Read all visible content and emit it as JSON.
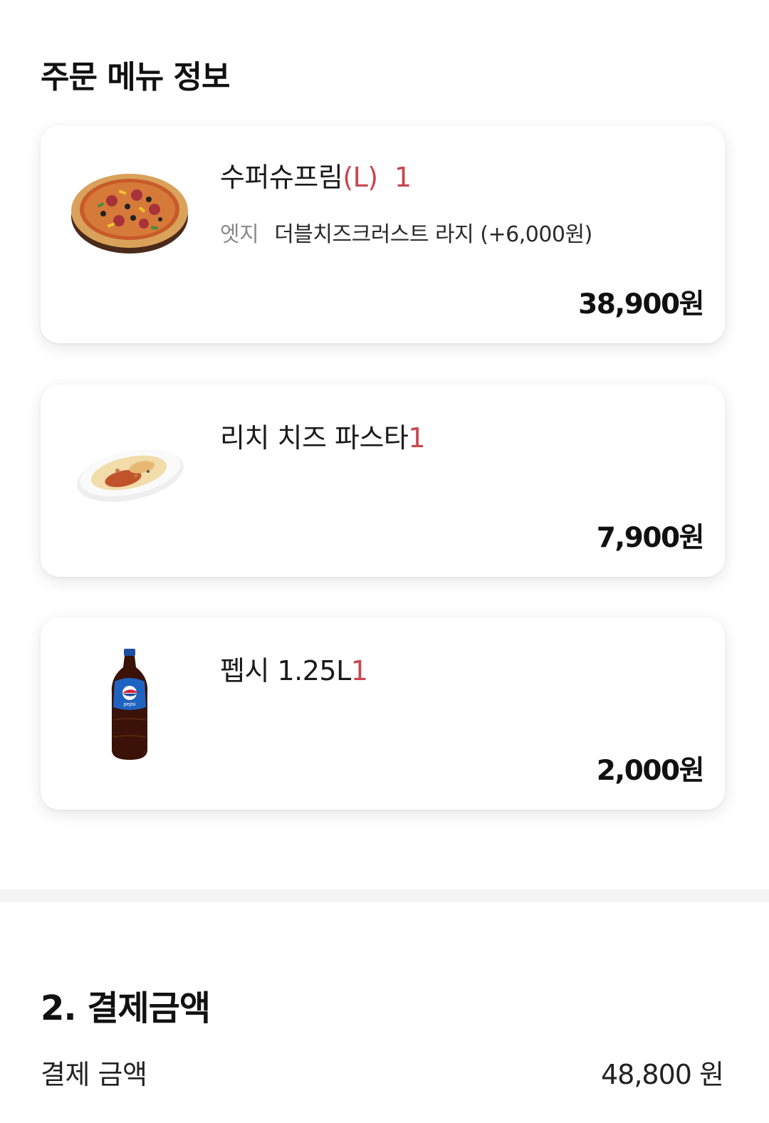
{
  "order_section": {
    "title": "주문 메뉴 정보"
  },
  "items": [
    {
      "name": "수퍼슈프림",
      "size": "(L)",
      "quantity": "1",
      "option_label": "엣지",
      "option_value": "더블치즈크러스트 라지 (+6,000원)",
      "price": "38,900원",
      "image_icon": "pizza-image"
    },
    {
      "name": "리치 치즈 파스타",
      "quantity": "1",
      "price": "7,900원",
      "image_icon": "pasta-image"
    },
    {
      "name": "펩시 1.25L",
      "quantity": "1",
      "price": "2,000원",
      "image_icon": "pepsi-bottle-image",
      "bottle_label": "pepsi"
    }
  ],
  "payment": {
    "title": "2. 결제금액",
    "label": "결제 금액",
    "amount": "48,800 원"
  },
  "colors": {
    "accent": "#c8454f",
    "divider": "#f4f4f4"
  }
}
